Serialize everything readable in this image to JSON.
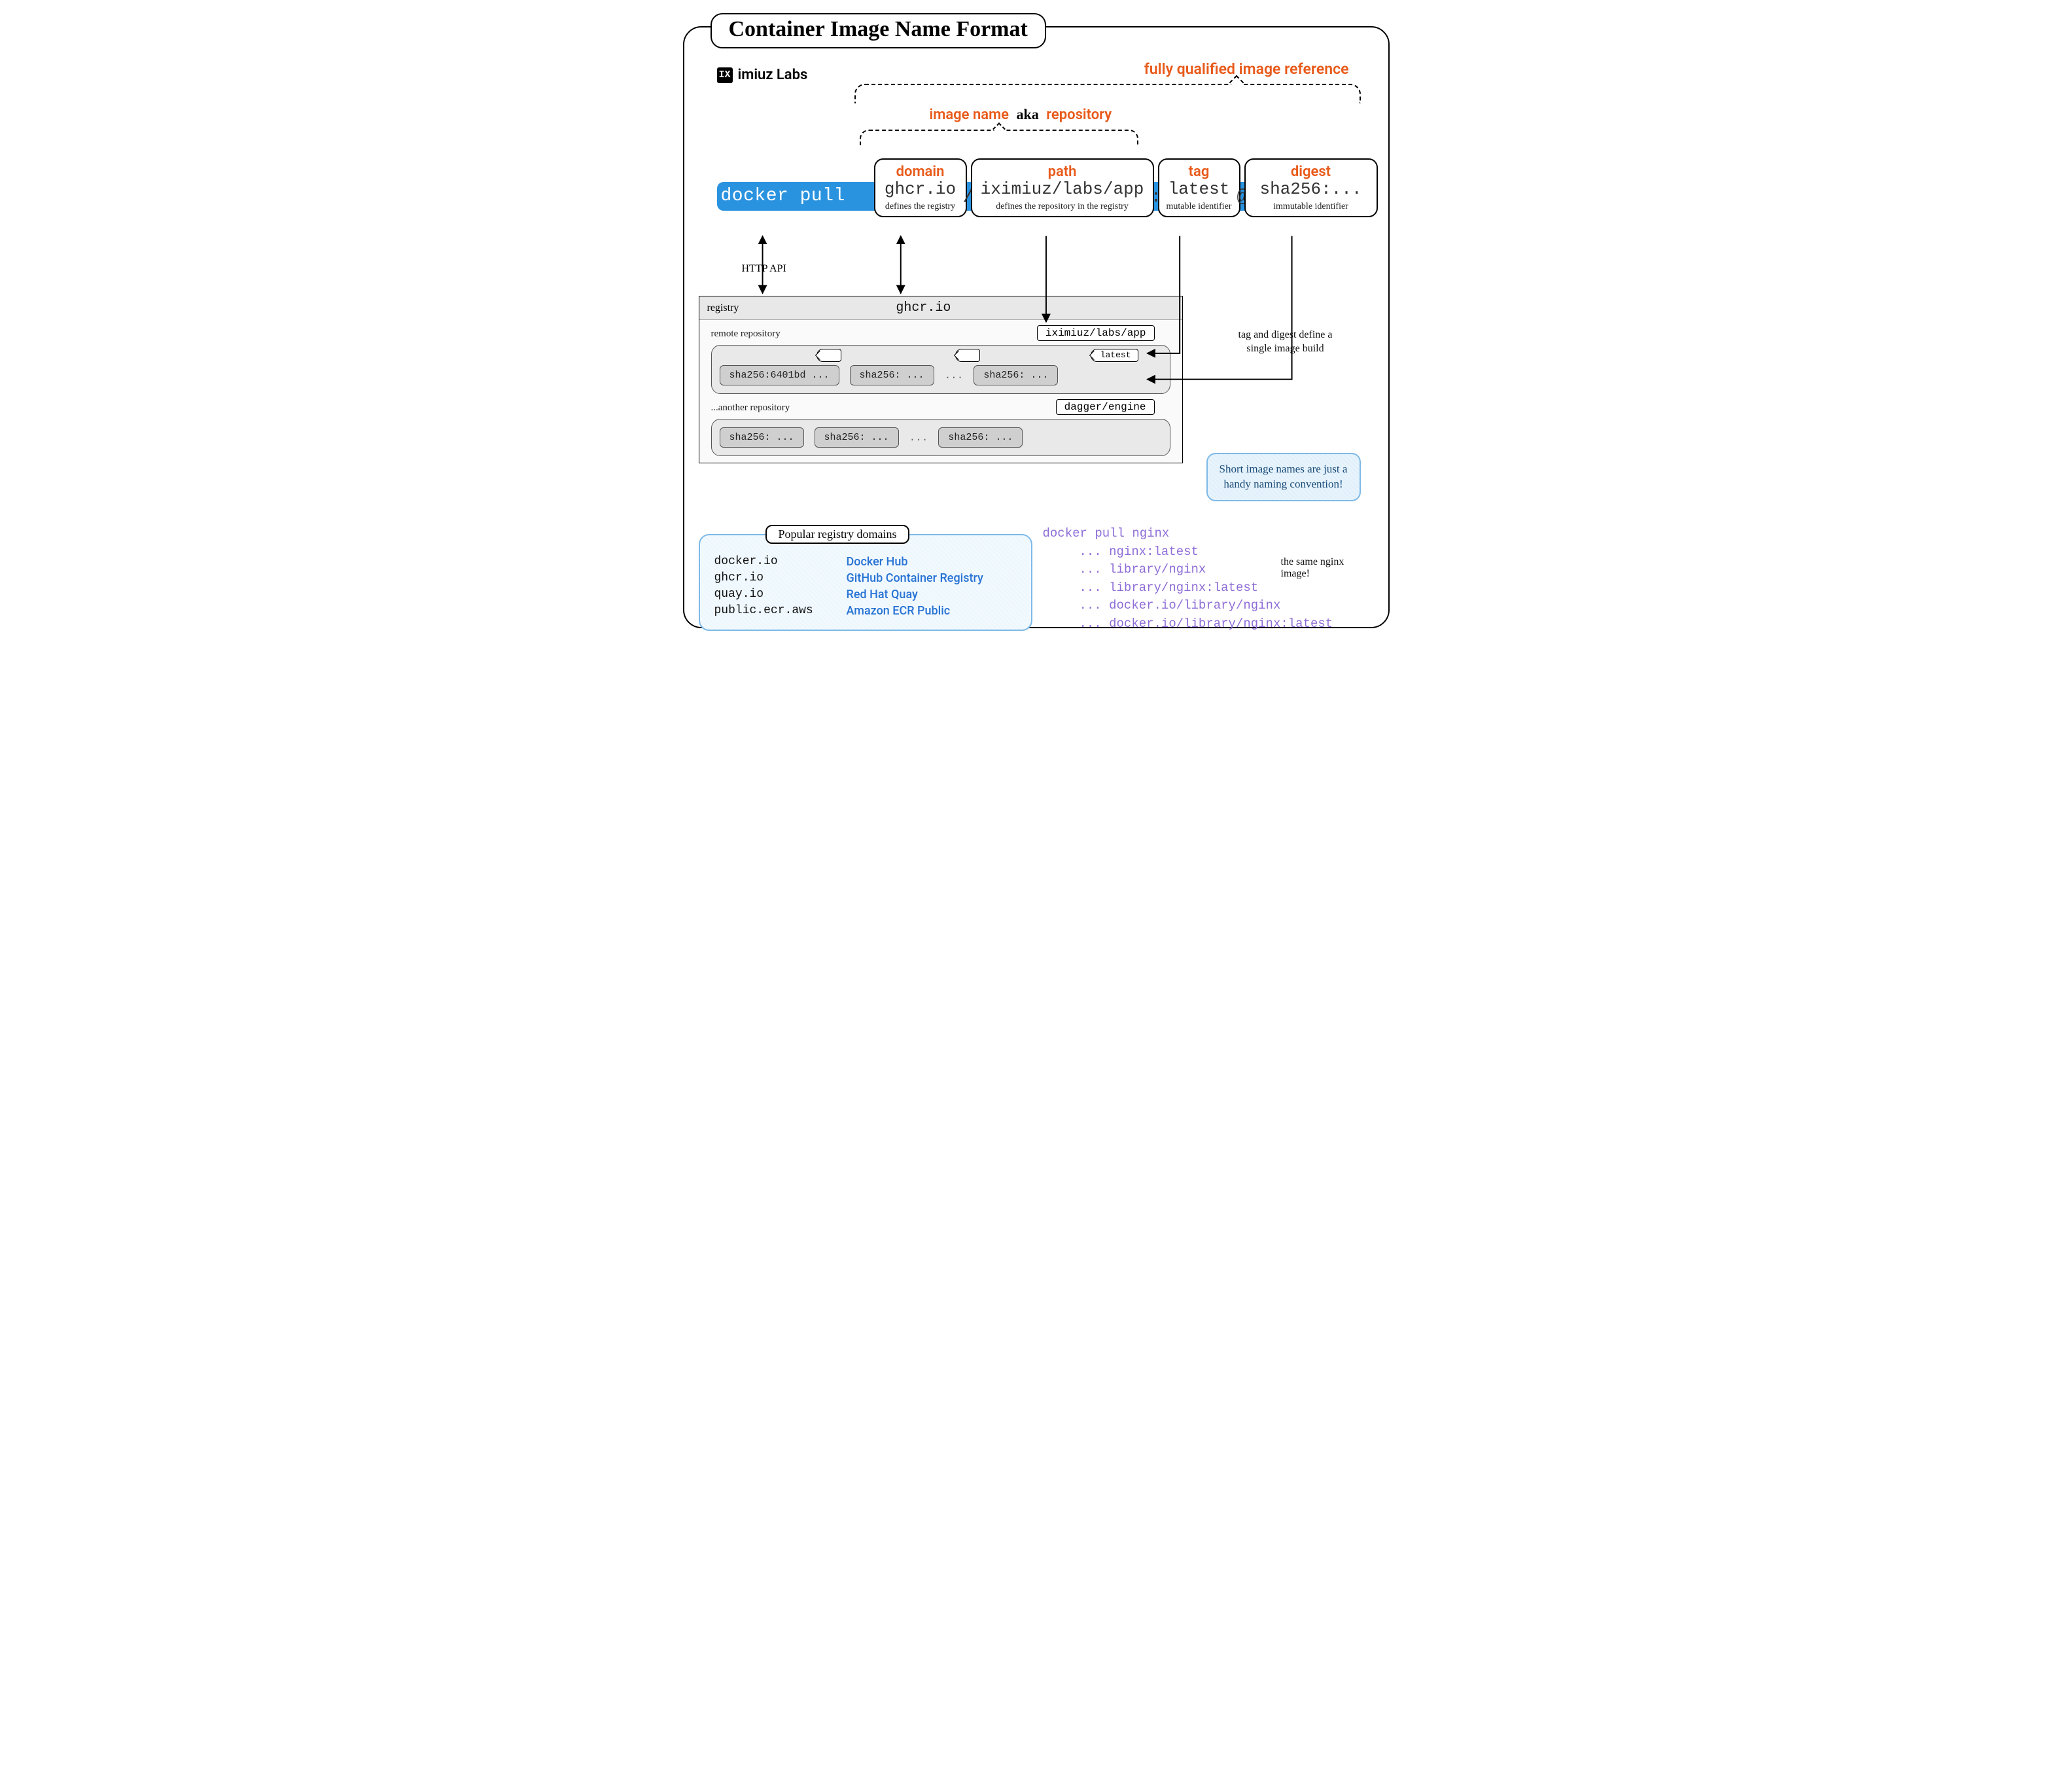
{
  "title": "Container Image Name Format",
  "brand": {
    "logo_text": "IX",
    "name": "imiuz Labs"
  },
  "fully_qualified_label": "fully qualified image reference",
  "name_aka": {
    "left": "image name",
    "mid": "aka",
    "right": "repository"
  },
  "cmd": "docker pull",
  "separators": {
    "slash": "/",
    "colon": ":",
    "at": "@"
  },
  "parts": {
    "domain": {
      "label": "domain",
      "text": "ghcr.io",
      "desc": "defines the registry"
    },
    "path": {
      "label": "path",
      "text": "iximiuz/labs/app",
      "desc": "defines the repository in the registry"
    },
    "tag": {
      "label": "tag",
      "text": "latest",
      "desc": "mutable identifier"
    },
    "digest": {
      "label": "digest",
      "text": "sha256:...",
      "desc": "immutable identifier"
    }
  },
  "http_api_label": "HTTP API",
  "registry": {
    "label": "registry",
    "domain": "ghcr.io",
    "repo1": {
      "label": "remote repository",
      "name": "iximiuz/labs/app",
      "latest_tag": "latest",
      "shas": [
        "sha256:6401bd ...",
        "sha256: ...",
        "sha256: ..."
      ]
    },
    "repo2": {
      "label": "...another repository",
      "name": "dagger/engine",
      "shas": [
        "sha256: ...",
        "sha256: ...",
        "sha256: ..."
      ]
    },
    "ellipsis": "..."
  },
  "note_tag_digest": "tag and digest define a single image build",
  "callout": "Short image names are just a handy naming convention!",
  "domains_card": {
    "title": "Popular registry domains",
    "rows": [
      {
        "domain": "docker.io",
        "registry": "Docker Hub"
      },
      {
        "domain": "ghcr.io",
        "registry": "GitHub Container Registry"
      },
      {
        "domain": "quay.io",
        "registry": "Red Hat Quay"
      },
      {
        "domain": "public.ecr.aws",
        "registry": "Amazon ECR Public"
      }
    ]
  },
  "equiv": {
    "head": "docker pull nginx",
    "rows": [
      "... nginx:latest",
      "... library/nginx",
      "... library/nginx:latest",
      "... docker.io/library/nginx",
      "... docker.io/library/nginx:latest"
    ]
  },
  "same_note": "the same nginx image!"
}
